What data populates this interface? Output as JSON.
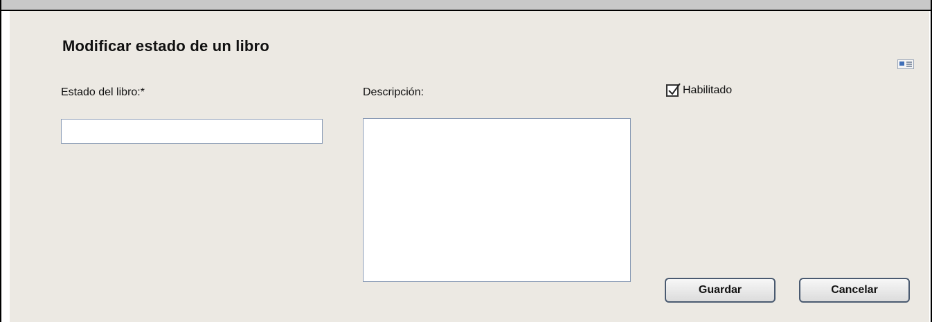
{
  "dialog": {
    "title": "Modificar estado de un libro"
  },
  "form": {
    "estado_label": "Estado del libro:*",
    "estado_value": "",
    "descripcion_label": "Descripción:",
    "descripcion_value": "",
    "habilitado_label": "Habilitado",
    "habilitado_checked": true
  },
  "buttons": {
    "save_label": "Guardar",
    "cancel_label": "Cancelar"
  },
  "icons": {
    "corner": "form-card-icon",
    "checkbox": "checkbox-checked-icon"
  }
}
